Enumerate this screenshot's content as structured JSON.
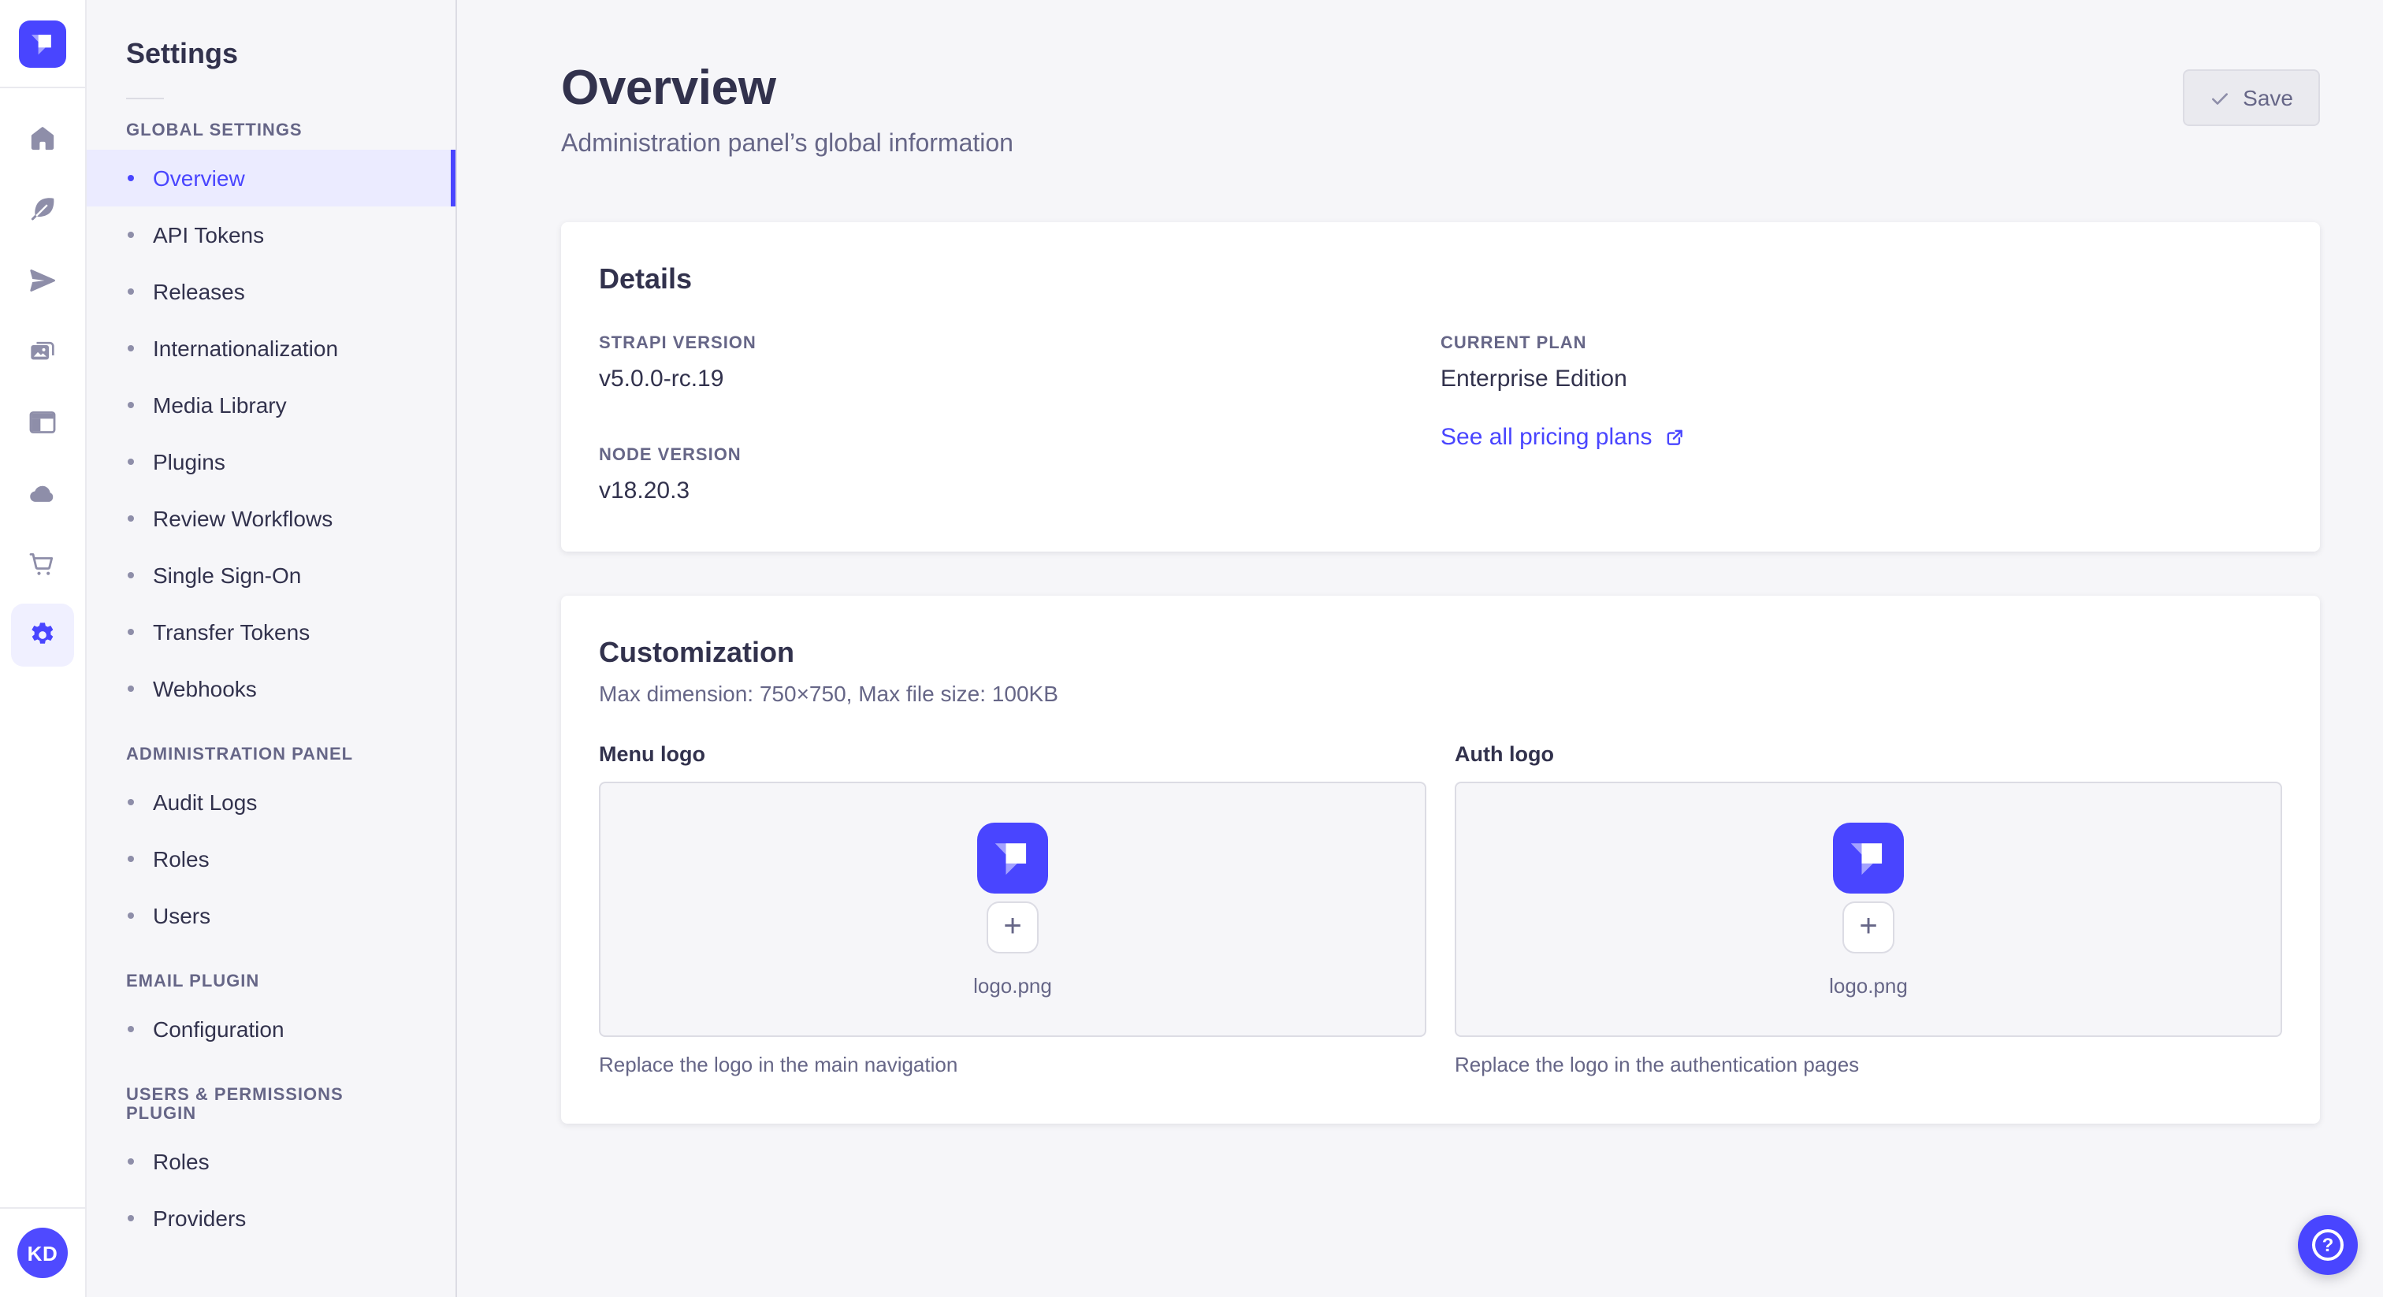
{
  "colors": {
    "accent": "#4945ff",
    "accent_active_bg": "#ebebff",
    "page_bg": "#f6f6f9",
    "text_primary": "#32324d",
    "text_secondary": "#666687",
    "rail_icon": "#8e8ea9"
  },
  "rail": {
    "logo_icon": "strapi-logo",
    "icons": [
      "home-icon",
      "feather-icon",
      "send-icon",
      "images-icon",
      "layout-icon",
      "cloud-icon",
      "cart-icon",
      "gear-icon"
    ],
    "active_icon": "gear-icon",
    "avatar_initials": "KD"
  },
  "sidebar": {
    "title": "Settings",
    "sections": [
      {
        "label": "GLOBAL SETTINGS",
        "items": [
          "Overview",
          "API Tokens",
          "Releases",
          "Internationalization",
          "Media Library",
          "Plugins",
          "Review Workflows",
          "Single Sign-On",
          "Transfer Tokens",
          "Webhooks"
        ]
      },
      {
        "label": "ADMINISTRATION PANEL",
        "items": [
          "Audit Logs",
          "Roles",
          "Users"
        ]
      },
      {
        "label": "EMAIL PLUGIN",
        "items": [
          "Configuration"
        ]
      },
      {
        "label": "USERS & PERMISSIONS PLUGIN",
        "items": [
          "Roles",
          "Providers"
        ]
      }
    ],
    "active_item": "Overview"
  },
  "header": {
    "title": "Overview",
    "subtitle": "Administration panel’s global information",
    "save_label": "Save"
  },
  "details": {
    "heading": "Details",
    "strapi_version": {
      "label": "STRAPI VERSION",
      "value": "v5.0.0-rc.19"
    },
    "current_plan": {
      "label": "CURRENT PLAN",
      "value": "Enterprise Edition"
    },
    "node_version": {
      "label": "NODE VERSION",
      "value": "v18.20.3"
    },
    "pricing_link_label": "See all pricing plans"
  },
  "customization": {
    "heading": "Customization",
    "subheading": "Max dimension: 750×750, Max file size: 100KB",
    "uploads": [
      {
        "label": "Menu logo",
        "filename": "logo.png",
        "hint": "Replace the logo in the main navigation"
      },
      {
        "label": "Auth logo",
        "filename": "logo.png",
        "hint": "Replace the logo in the authentication pages"
      }
    ]
  },
  "help": {
    "icon": "question-mark-icon"
  }
}
